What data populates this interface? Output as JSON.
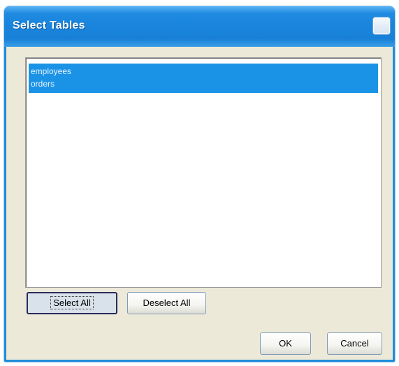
{
  "window": {
    "title": "Select Tables"
  },
  "list": {
    "items": [
      "employees",
      "orders"
    ],
    "selected": [
      "employees",
      "orders"
    ]
  },
  "buttons": {
    "select_all": "Select All",
    "deselect_all": "Deselect All",
    "ok": "OK",
    "cancel": "Cancel"
  },
  "colors": {
    "titlebar": "#1e8ae0",
    "selection": "#1a93e6",
    "dialog_background": "#ece9d8"
  }
}
